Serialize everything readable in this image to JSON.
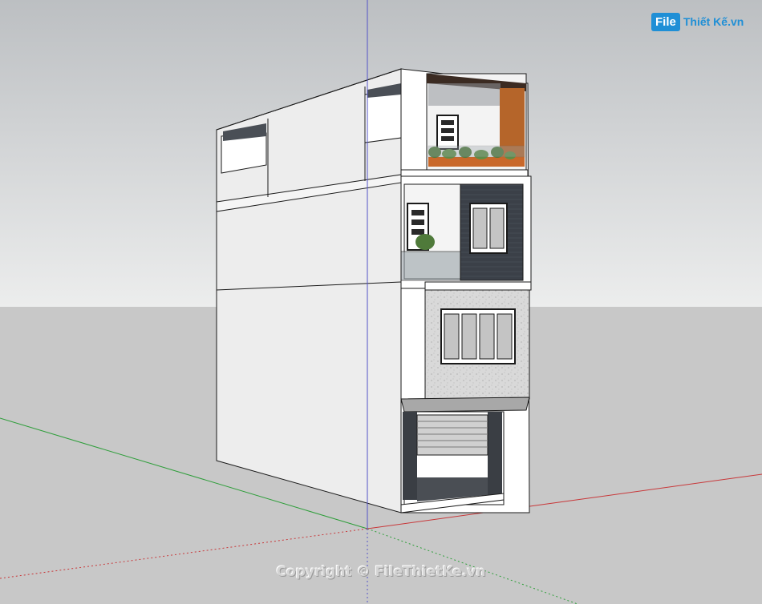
{
  "watermark": {
    "logo_box": "File",
    "logo_text": "Thiết Kế.vn"
  },
  "footer": {
    "copyright": "Copyright © FileThietKe.vn"
  },
  "colors": {
    "sky_top": "#bcbfc2",
    "sky_bottom": "#eceded",
    "ground": "#c8c8c8",
    "red_axis": "#c8383a",
    "green_axis": "#2e9e3a",
    "blue_axis": "#5353c7",
    "wood_accent": "#b5652a",
    "dark_tile": "#3b4048",
    "stone": "#d6d6d6",
    "logo_blue": "#1f8fd6"
  }
}
